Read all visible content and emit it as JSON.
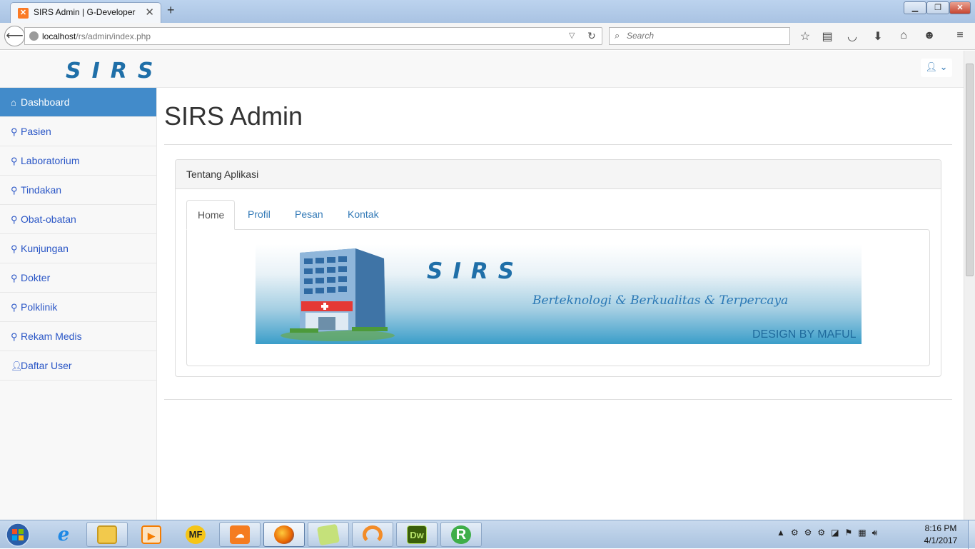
{
  "browser": {
    "tab_title": "SIRS Admin | G-Developer",
    "tab_favicon": "xampp-favicon-icon",
    "url_host": "localhost",
    "url_path": "/rs/admin/index.php",
    "search_placeholder": "Search",
    "toolbar_icons": [
      "bookmark-star-icon",
      "reading-list-icon",
      "pocket-icon",
      "download-icon",
      "home-icon",
      "chat-icon",
      "menu-icon"
    ]
  },
  "site": {
    "brand": "SIRS",
    "brand_color": "#1f6fa8"
  },
  "sidebar": {
    "items": [
      {
        "label": "Dashboard",
        "icon": "home-icon",
        "active": true
      },
      {
        "label": "Pasien",
        "icon": "paperclip-icon"
      },
      {
        "label": "Laboratorium",
        "icon": "paperclip-icon"
      },
      {
        "label": "Tindakan",
        "icon": "paperclip-icon"
      },
      {
        "label": "Obat-obatan",
        "icon": "paperclip-icon"
      },
      {
        "label": "Kunjungan",
        "icon": "paperclip-icon"
      },
      {
        "label": "Dokter",
        "icon": "paperclip-icon"
      },
      {
        "label": "Polklinik",
        "icon": "paperclip-icon"
      },
      {
        "label": "Rekam Medis",
        "icon": "paperclip-icon"
      },
      {
        "label": "Daftar User",
        "icon": "user-icon"
      }
    ]
  },
  "main": {
    "title": "SIRS Admin",
    "panel_heading": "Tentang Aplikasi",
    "tabs": [
      {
        "label": "Home",
        "active": true
      },
      {
        "label": "Profil"
      },
      {
        "label": "Pesan"
      },
      {
        "label": "Kontak"
      }
    ],
    "banner": {
      "brand": "SIRS",
      "tagline": "Berteknologi & Berkualitas & Terpercaya",
      "credit": "DESIGN BY MAFUL"
    }
  },
  "taskbar": {
    "apps": [
      {
        "name": "internet-explorer-icon",
        "label": "e",
        "color": "#1e88e5"
      },
      {
        "name": "file-explorer-icon",
        "label": "",
        "color": "#f2c94c"
      },
      {
        "name": "media-player-icon",
        "label": "",
        "color": "#f57c00"
      },
      {
        "name": "mediafire-icon",
        "label": "MF",
        "color": "#f5c518"
      },
      {
        "name": "uc-browser-icon",
        "label": "",
        "color": "#f57c20"
      },
      {
        "name": "firefox-icon",
        "label": "",
        "color": "#e66000"
      },
      {
        "name": "sticky-notes-icon",
        "label": "",
        "color": "#c5e17a"
      },
      {
        "name": "sync-app-icon",
        "label": "",
        "color": "#f28c28"
      },
      {
        "name": "dreamweaver-icon",
        "label": "Dw",
        "color": "#3b5f0b"
      },
      {
        "name": "r-app-icon",
        "label": "R",
        "color": "#3fae49"
      }
    ],
    "time": "8:16 PM",
    "date": "4/1/2017"
  }
}
